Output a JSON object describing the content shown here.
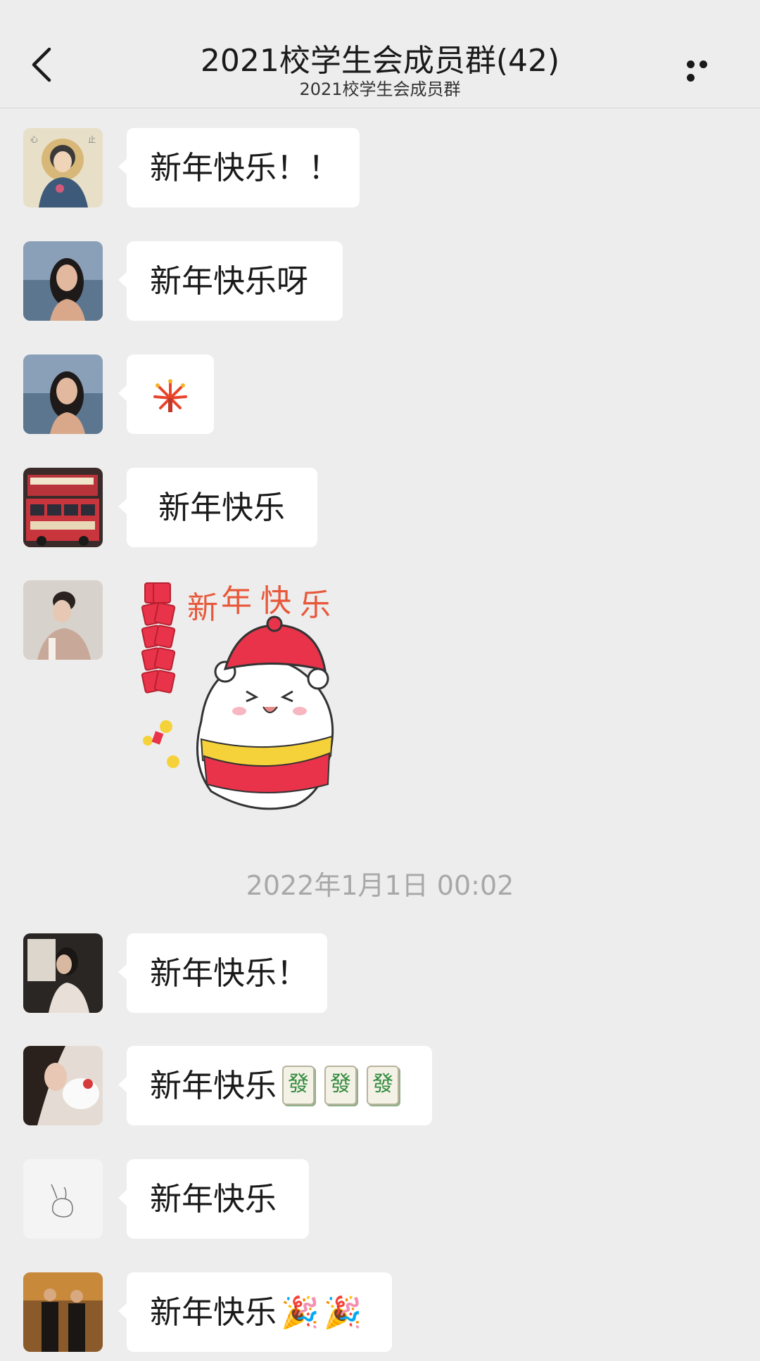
{
  "header": {
    "title": "2021校学生会成员群(42)",
    "subtitle": "2021校学生会成员群",
    "back_icon": "chevron-left-icon",
    "more_icon": "more-dots-icon"
  },
  "messages_before": [
    {
      "text": "新年快乐！！",
      "avatar": "avatar-illustrated-person"
    },
    {
      "text": "新年快乐呀",
      "avatar": "avatar-woman-sea"
    },
    {
      "text": "🎇",
      "avatar": "avatar-woman-sea"
    },
    {
      "text": "新年快乐",
      "avatar": "avatar-red-bus"
    },
    {
      "sticker_text": "新年快乐",
      "avatar": "avatar-woman-portrait"
    }
  ],
  "timestamp": "2022年1月1日 00:02",
  "messages_after": [
    {
      "text": "新年快乐！",
      "avatar": "avatar-woman-window"
    },
    {
      "text": "新年快乐",
      "tiles": [
        "發",
        "發",
        "發"
      ],
      "avatar": "avatar-girl-cat"
    },
    {
      "text": "新年快乐",
      "avatar": "avatar-sketch-rabbit"
    },
    {
      "text": "新年快乐",
      "emojis": [
        "🎉",
        "🎉"
      ],
      "avatar": "avatar-two-men"
    }
  ]
}
